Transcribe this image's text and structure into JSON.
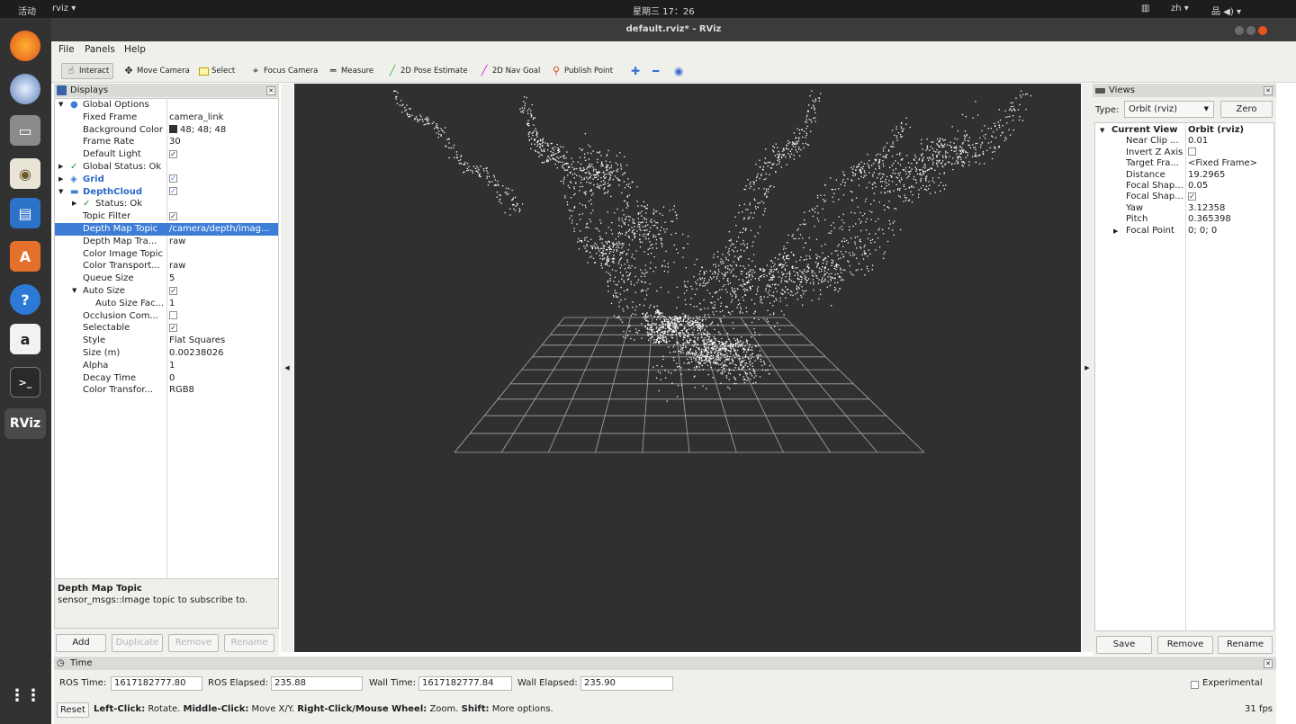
{
  "topbar": {
    "activities": "活动",
    "app_menu": "rviz ▾",
    "clock": "星期三 17：26",
    "lang": "zh ▾",
    "status_icons": "品 ◀) ▾"
  },
  "window": {
    "title": "default.rviz* - RViz"
  },
  "menu": {
    "file": "File",
    "panels": "Panels",
    "help": "Help"
  },
  "toolbar": {
    "interact": "Interact",
    "move_camera": "Move Camera",
    "select": "Select",
    "focus_camera": "Focus Camera",
    "measure": "Measure",
    "pose_estimate": "2D Pose Estimate",
    "nav_goal": "2D Nav Goal",
    "publish_point": "Publish Point"
  },
  "displays": {
    "title": "Displays",
    "rows": [
      {
        "key": "Global Options",
        "value": ""
      },
      {
        "key": "Fixed Frame",
        "value": "camera_link"
      },
      {
        "key": "Background Color",
        "value": "48; 48; 48"
      },
      {
        "key": "Frame Rate",
        "value": "30"
      },
      {
        "key": "Default Light",
        "value": ""
      },
      {
        "key": "Global Status: Ok",
        "value": ""
      },
      {
        "key": "Grid",
        "value": ""
      },
      {
        "key": "DepthCloud",
        "value": ""
      },
      {
        "key": "Status: Ok",
        "value": ""
      },
      {
        "key": "Topic Filter",
        "value": ""
      },
      {
        "key": "Depth Map Topic",
        "value": "/camera/depth/imag..."
      },
      {
        "key": "Depth Map Tra...",
        "value": "raw"
      },
      {
        "key": "Color Image Topic",
        "value": ""
      },
      {
        "key": "Color Transport...",
        "value": "raw"
      },
      {
        "key": "Queue Size",
        "value": "5"
      },
      {
        "key": "Auto Size",
        "value": ""
      },
      {
        "key": "Auto Size Fac...",
        "value": "1"
      },
      {
        "key": "Occlusion Com...",
        "value": ""
      },
      {
        "key": "Selectable",
        "value": ""
      },
      {
        "key": "Style",
        "value": "Flat Squares"
      },
      {
        "key": "Size (m)",
        "value": "0.00238026"
      },
      {
        "key": "Alpha",
        "value": "1"
      },
      {
        "key": "Decay Time",
        "value": "0"
      },
      {
        "key": "Color Transfor...",
        "value": "RGB8"
      }
    ],
    "desc_title": "Depth Map Topic",
    "desc_text": "sensor_msgs::Image topic to subscribe to.",
    "btn_add": "Add",
    "btn_duplicate": "Duplicate",
    "btn_remove": "Remove",
    "btn_rename": "Rename"
  },
  "views": {
    "title": "Views",
    "type_label": "Type:",
    "type_value": "Orbit (rviz)",
    "zero": "Zero",
    "rows": [
      {
        "key": "Current View",
        "value": "Orbit (rviz)"
      },
      {
        "key": "Near Clip ...",
        "value": "0.01"
      },
      {
        "key": "Invert Z Axis",
        "value": ""
      },
      {
        "key": "Target Fra...",
        "value": "<Fixed Frame>"
      },
      {
        "key": "Distance",
        "value": "19.2965"
      },
      {
        "key": "Focal Shap...",
        "value": "0.05"
      },
      {
        "key": "Focal Shap...",
        "value": ""
      },
      {
        "key": "Yaw",
        "value": "3.12358"
      },
      {
        "key": "Pitch",
        "value": "0.365398"
      },
      {
        "key": "Focal Point",
        "value": "0; 0; 0"
      }
    ],
    "save": "Save",
    "remove": "Remove",
    "rename": "Rename"
  },
  "time": {
    "title": "Time",
    "ros_time_label": "ROS Time:",
    "ros_time": "1617182777.80",
    "ros_elapsed_label": "ROS Elapsed:",
    "ros_elapsed": "235.88",
    "wall_time_label": "Wall Time:",
    "wall_time": "1617182777.84",
    "wall_elapsed_label": "Wall Elapsed:",
    "wall_elapsed": "235.90",
    "experimental": "Experimental"
  },
  "status": {
    "reset": "Reset",
    "left_click": "Left-Click:",
    "left_desc": "Rotate.",
    "middle_click": "Middle-Click:",
    "middle_desc": "Move X/Y.",
    "right_click": "Right-Click/Mouse Wheel:",
    "right_desc": "Zoom.",
    "shift": "Shift:",
    "shift_desc": "More options.",
    "fps": "31 fps"
  },
  "dock": {
    "rviz_label": "RViz"
  },
  "colors": {
    "viewport_bg": "#303030",
    "selection": "#3d7dd8",
    "dock_bg": "#323232",
    "cloud": "#ffffff"
  }
}
